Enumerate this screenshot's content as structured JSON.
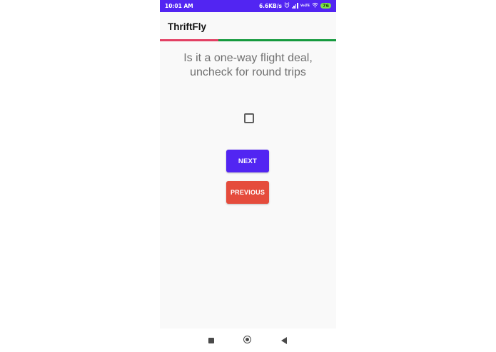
{
  "status_bar": {
    "time": "10:01 AM",
    "network_speed": "6.6KB/s",
    "alarm_icon": "alarm-icon",
    "signal_icon": "signal-icon",
    "signal_small_text": "VoLTE",
    "wifi_icon": "wifi-icon",
    "battery_level": "76",
    "background_color": "#5225f2"
  },
  "app_bar": {
    "title": "ThriftFly"
  },
  "progress": {
    "fraction": 0.33,
    "colors": [
      "#e23f63",
      "#159a3e"
    ]
  },
  "main": {
    "question": "Is it a one-way flight deal, uncheck for round trips",
    "checkbox_checked": false,
    "next_label": "NEXT",
    "previous_label": "PREVIOUS",
    "next_color": "#5225f2",
    "previous_color": "#e54c3c"
  },
  "nav_bar": {
    "recents_icon": "square-icon",
    "home_icon": "circle-home-icon",
    "back_icon": "triangle-back-icon"
  }
}
